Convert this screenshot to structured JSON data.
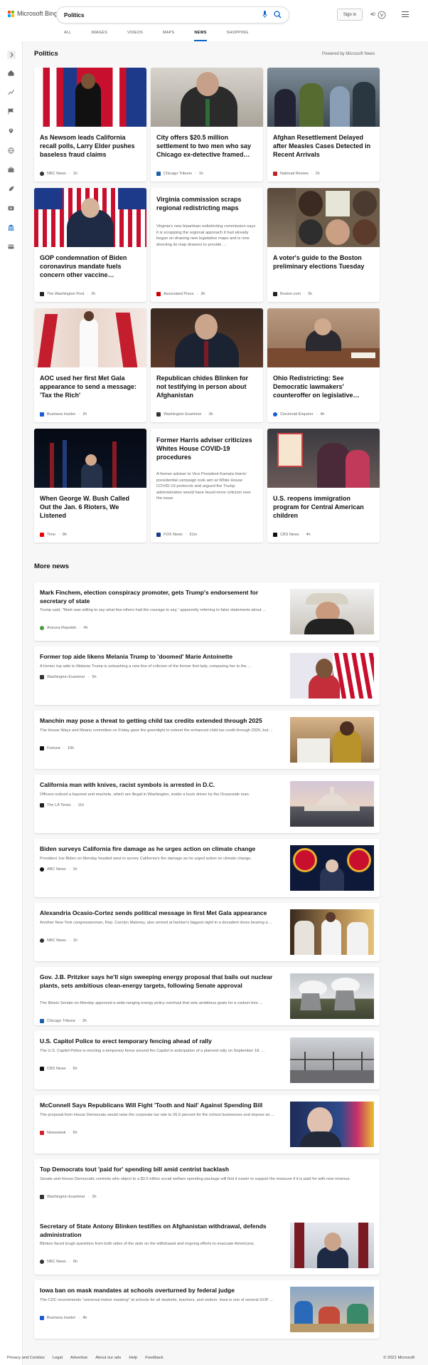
{
  "header": {
    "logo_text": "Microsoft Bing",
    "search_value": "Politics",
    "sign_in": "Sign in",
    "rewards_points": "40",
    "tabs": [
      "ALL",
      "IMAGES",
      "VIDEOS",
      "MAPS",
      "NEWS",
      "SHOPPING"
    ],
    "active_tab": "NEWS",
    "brand_colors": [
      "#f25022",
      "#7fba00",
      "#00a4ef",
      "#ffb900"
    ],
    "accent": "#0a64c8"
  },
  "sidebar": {
    "icons": [
      "expand-icon",
      "home-icon",
      "trending-icon",
      "flag-icon",
      "location-icon",
      "globe-icon",
      "briefcase-icon",
      "rocket-icon",
      "video-icon",
      "politics-icon",
      "card-icon"
    ]
  },
  "politics": {
    "title": "Politics",
    "powered": "Powered by Microsoft News",
    "cards": [
      {
        "title": "As Newsom leads California recall polls, Larry Elder pushes baseless fraud claims",
        "source": "NBC News",
        "time": "1h"
      },
      {
        "title": "City offers $20.5 million settlement to two men who say Chicago ex-detective framed…",
        "source": "Chicago Tribune",
        "time": "1h"
      },
      {
        "title": "Afghan Resettlement Delayed after Measles Cases Detected in Recent Arrivals",
        "source": "National Review",
        "time": "2h"
      },
      {
        "title": "GOP condemnation of Biden coronavirus mandate fuels concern other vaccine…",
        "source": "The Washington Post",
        "time": "2h"
      },
      {
        "title": "Virginia commission scraps regional redistricting maps",
        "desc": "Virginia's new bipartisan redistricting commission says it is scrapping the regional approach it had already begun on drawing new legislative maps and is now directing its map drawers to provide ...",
        "source": "Associated Press",
        "time": "3h"
      },
      {
        "title": "A voter's guide to the Boston preliminary elections Tuesday",
        "source": "Boston.com",
        "time": "3h"
      },
      {
        "title": "AOC used her first Met Gala appearance to send a message: 'Tax the Rich'",
        "source": "Business Insider",
        "time": "2h"
      },
      {
        "title": "Republican chides Blinken for not testifying in person about Afghanistan",
        "source": "Washington Examiner",
        "time": "3h"
      },
      {
        "title": "Ohio Redistricting: See Democratic lawmakers' counteroffer on legislative…",
        "source": "Cincinnati Enquirer",
        "time": "4h"
      },
      {
        "title": "When George W. Bush Called Out the Jan. 6 Rioters, We Listened",
        "source": "Time",
        "time": "8h"
      },
      {
        "title": "Former Harris adviser criticizes Whites House COVID-19 procedures",
        "desc": "A former adviser to Vice President Kamala Harris' presidential campaign took aim at White House COVID-19 protocols and argued the Trump administration would have faced more criticism over the issue.",
        "source": "FOX News",
        "time": "51m"
      },
      {
        "title": "U.S. reopens immigration program for Central American children",
        "source": "CBS News",
        "time": "4h"
      }
    ]
  },
  "more": {
    "title": "More news",
    "items": [
      {
        "title": "Mark Finchem, election conspiracy promoter, gets Trump's endorsement for secretary of state",
        "desc": "Trump said, \"Mark was willing to say what few others had the courage to say,\" apparently referring to false statements about ...",
        "source": "Arizona Republic",
        "time": "4h"
      },
      {
        "title": "Former top aide likens Melania Trump to 'doomed' Marie Antoinette",
        "desc": "A former top aide to Melania Trump is unleashing a new line of criticism of the former first lady, comparing her to the ...",
        "source": "Washington Examiner",
        "time": "5h"
      },
      {
        "title": "Manchin may pose a threat to getting child tax credits extended through 2025",
        "desc": "The House Ways and Means committee on Friday gave the greenlight to extend the enhanced child tax credit through 2025, but ...",
        "source": "Fortune",
        "time": "10h"
      },
      {
        "title": "California man with knives, racist symbols is arrested in D.C.",
        "desc": "Officers noticed a bayonet and machete, which are illegal in Washington, inside a truck driven by the Oceanside man.",
        "source": "The LA Times",
        "time": "11h"
      },
      {
        "title": "Biden surveys California fire damage as he urges action on climate change",
        "desc": "President Joe Biden on Monday headed west to survey California's fire damage as he urged action on climate change.",
        "source": "ABC News",
        "time": "1h"
      },
      {
        "title": "Alexandria Ocasio-Cortez sends political message in first Met Gala appearance",
        "desc": "Another New York congresswoman, Rep. Carolyn Maloney, also arrived at fashion's biggest night in a decadent dress bearing a ...",
        "source": "NBC News",
        "time": "1h"
      },
      {
        "title": "Gov. J.B. Pritzker says he'll sign sweeping energy proposal that bails out nuclear plants, sets ambitious clean-energy targets, following Senate approval",
        "desc": "The Illinois Senate on Monday approved a wide-ranging energy policy overhaul that sets ambitious goals for a carbon-free ...",
        "source": "Chicago Tribune",
        "time": "3h"
      },
      {
        "title": "U.S. Capitol Police to erect temporary fencing ahead of rally",
        "desc": "The U.S. Capitol Police is erecting a temporary fence around the Capitol in anticipation of a planned rally on September 18. ...",
        "source": "CBS News",
        "time": "5h"
      },
      {
        "title": "McConnell Says Republicans Will Fight 'Tooth and Nail' Against Spending Bill",
        "desc": "The proposal from House Democrats would raise the corporate tax rate to 26.5 percent for the richest businesses and impose an ...",
        "source": "Newsweek",
        "time": "5h"
      },
      {
        "title": "Top Democrats tout 'paid for' spending bill amid centrist backlash",
        "desc": "Senate and House Democratic centrists who object to a $3.5 trillion social welfare spending package will find it easier to support the measure if it is paid for with new revenue.",
        "source": "Washington Examiner",
        "time": "3h"
      },
      {
        "title": "Secretary of State Antony Blinken testifies on Afghanistan withdrawal, defends administration",
        "desc": "Blinken faced tough questions from both sides of the aisle on the withdrawal and ongoing efforts to evacuate Americans.",
        "source": "NBC News",
        "time": "6h"
      },
      {
        "title": "Iowa ban on mask mandates at schools overturned by federal judge",
        "desc": "The CDC recommends \"universal indoor masking\" at schools for all students, teachers, and visitors. Iowa is one of several GOP ...",
        "source": "Business Insider",
        "time": "4h"
      }
    ]
  },
  "footer": {
    "links": [
      "Privacy and Cookies",
      "Legal",
      "Advertise",
      "About our ads",
      "Help",
      "Feedback"
    ],
    "copyright": "© 2021 Microsoft"
  }
}
